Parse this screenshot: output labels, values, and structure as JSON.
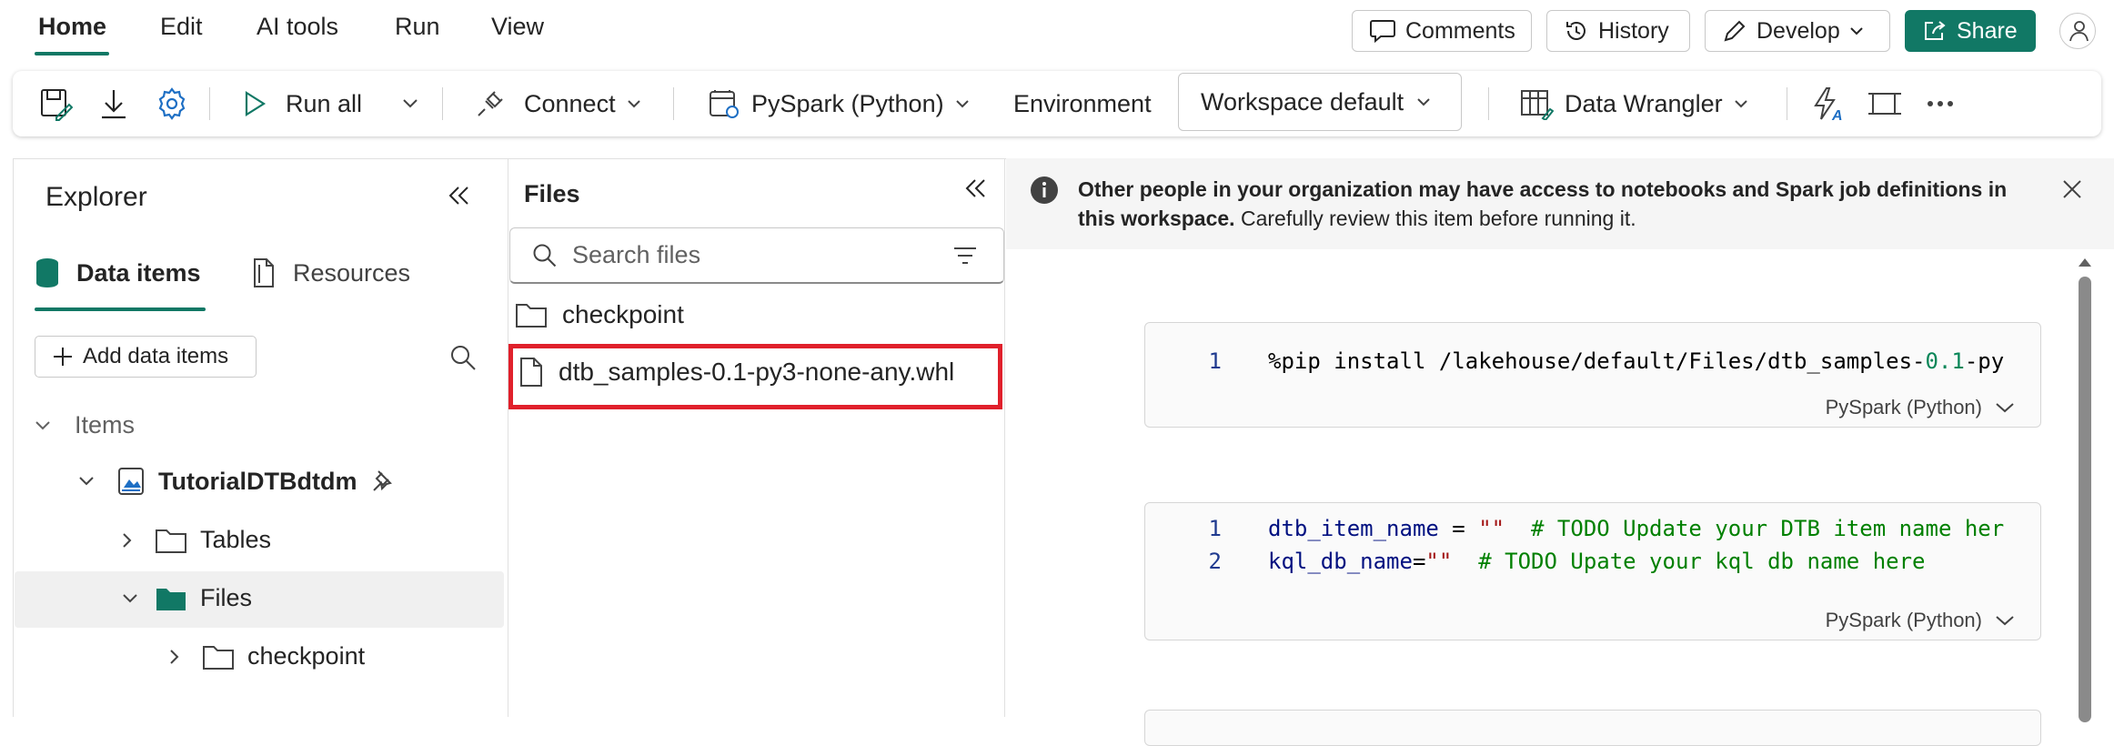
{
  "menu": {
    "tabs": [
      "Home",
      "Edit",
      "AI tools",
      "Run",
      "View"
    ]
  },
  "top_buttons": {
    "comments": "Comments",
    "history": "History",
    "develop": "Develop",
    "share": "Share"
  },
  "toolbar": {
    "run_all": "Run all",
    "connect": "Connect",
    "language": "PySpark (Python)",
    "environment_label": "Environment",
    "environment_value": "Workspace default",
    "data_wrangler": "Data Wrangler"
  },
  "explorer": {
    "title": "Explorer",
    "tabs": [
      "Data items",
      "Resources"
    ],
    "add_button": "Add data items",
    "tree": {
      "items_label": "Items",
      "lakehouse": "TutorialDTBdtdm",
      "tables": "Tables",
      "files": "Files",
      "checkpoint": "checkpoint"
    }
  },
  "files_panel": {
    "title": "Files",
    "search_placeholder": "Search files",
    "entries": [
      "checkpoint",
      "dtb_samples-0.1-py3-none-any.whl"
    ]
  },
  "info_bar": {
    "bold": "Other people in your organization may have access to notebooks and Spark job definitions in this workspace.",
    "rest": " Carefully review this item before running it."
  },
  "cells": [
    {
      "language": "PySpark (Python)",
      "lines": [
        {
          "n": "1",
          "parts": [
            [
              "",
              "%pip install /lakehouse/default/Files/dtb_samples-"
            ],
            [
              "num",
              "0.1"
            ],
            [
              "",
              "-py"
            ]
          ]
        }
      ]
    },
    {
      "language": "PySpark (Python)",
      "lines": [
        {
          "n": "1",
          "parts": [
            [
              "var",
              "dtb_item_name"
            ],
            [
              "",
              " = "
            ],
            [
              "str",
              "\"\""
            ],
            [
              "",
              "  "
            ],
            [
              "cmt",
              "# TODO Update your DTB item name her"
            ]
          ]
        },
        {
          "n": "2",
          "parts": [
            [
              "var",
              "kql_db_name"
            ],
            [
              "",
              "="
            ],
            [
              "str",
              "\"\""
            ],
            [
              "",
              "  "
            ],
            [
              "cmt",
              "# TODO Upate your kql db name here"
            ]
          ]
        }
      ]
    }
  ],
  "colors": {
    "accent": "#117865",
    "highlight": "#e0202b"
  }
}
